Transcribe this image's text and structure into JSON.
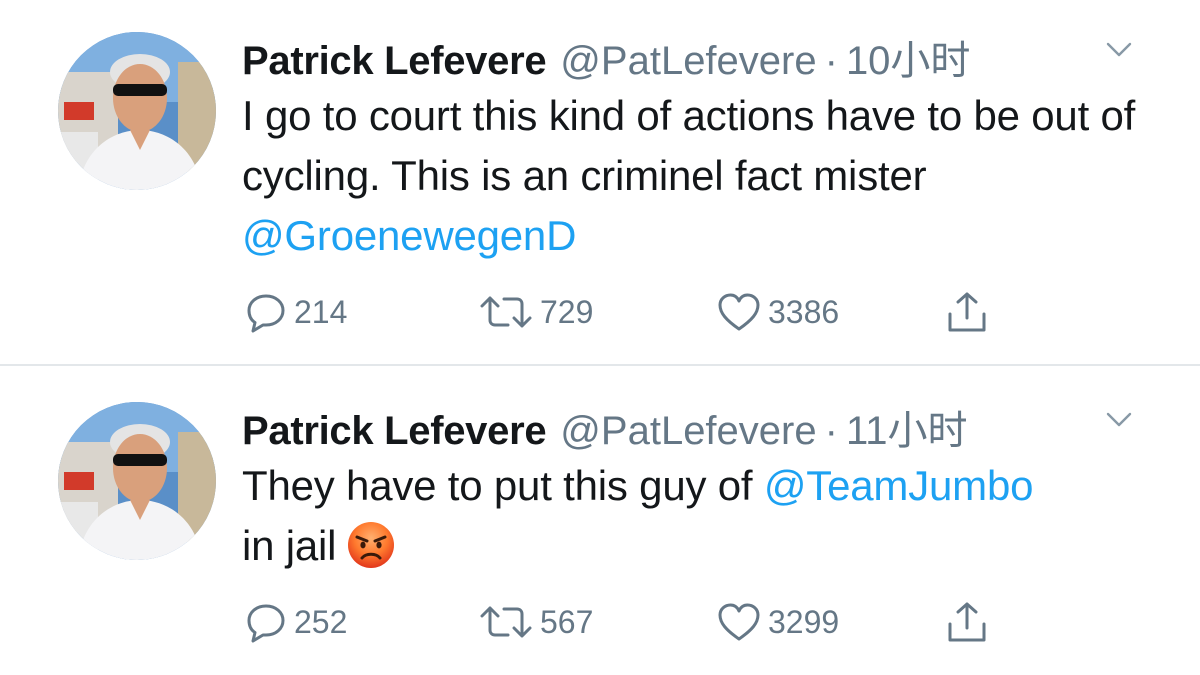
{
  "tweets": [
    {
      "author_name": "Patrick Lefevere",
      "handle": "@PatLefevere",
      "separator": "·",
      "time": "10小时",
      "text_parts": [
        "I go to court this kind of actions have to be out of cycling.  This is an criminel fact mister ",
        "@GroenewegenD"
      ],
      "replies": "214",
      "retweets": "729",
      "likes": "3386"
    },
    {
      "author_name": "Patrick Lefevere",
      "handle": "@PatLefevere",
      "separator": "·",
      "time": "11小时",
      "text_parts": [
        "They have to put this guy of ",
        "@TeamJumbo",
        "in jail"
      ],
      "emoji": "angry-face-emoji",
      "replies": "252",
      "retweets": "567",
      "likes": "3299"
    }
  ],
  "icons": {
    "reply": "reply-icon",
    "retweet": "retweet-icon",
    "like": "heart-icon",
    "share": "share-icon",
    "caret": "chevron-down-icon"
  },
  "colors": {
    "link": "#1da1f2",
    "secondary_text": "#657786",
    "primary_text": "#14171a",
    "divider": "#e3e7ea"
  }
}
